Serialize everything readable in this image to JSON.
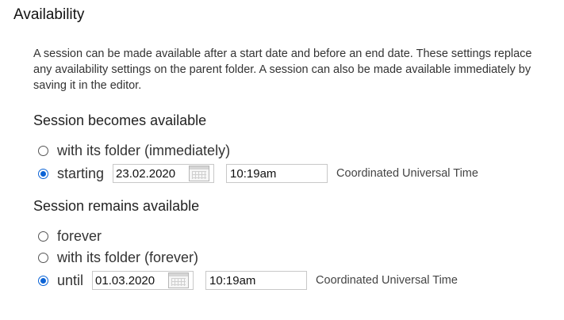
{
  "title": "Availability",
  "description": "A session can be made available after a start date and before an end date. These settings replace any availability settings on the parent folder. A session can also be made available immediately by saving it in the editor.",
  "becomes": {
    "heading": "Session becomes available",
    "options": {
      "with_folder": {
        "label": "with its folder (immediately)",
        "checked": false
      },
      "starting": {
        "label": "starting",
        "checked": true,
        "date": "23.02.2020",
        "time": "10:19am",
        "timezone": "Coordinated Universal Time"
      }
    }
  },
  "remains": {
    "heading": "Session remains available",
    "options": {
      "forever": {
        "label": "forever",
        "checked": false
      },
      "with_folder": {
        "label": "with its folder (forever)",
        "checked": false
      },
      "until": {
        "label": "until",
        "checked": true,
        "date": "01.03.2020",
        "time": "10:19am",
        "timezone": "Coordinated Universal Time"
      }
    }
  },
  "colors": {
    "accent": "#0b63d6",
    "text": "#333333",
    "border": "#c8c8c8"
  },
  "icons": {
    "calendar": "calendar-icon"
  }
}
